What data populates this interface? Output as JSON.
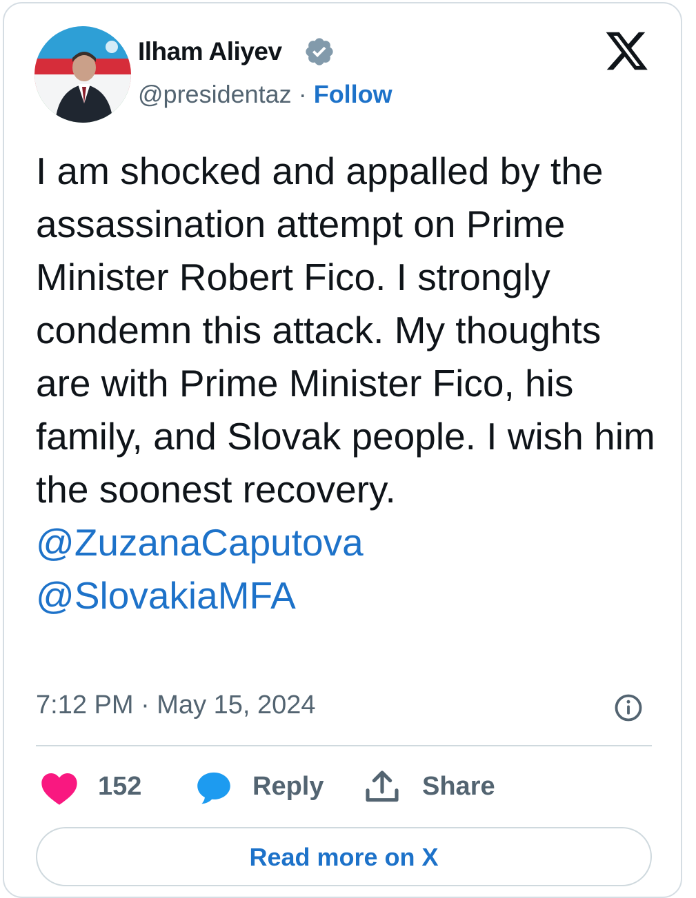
{
  "author": {
    "name": "Ilham Aliyev",
    "handle": "@presidentaz",
    "separator": "·",
    "follow_label": "Follow",
    "verified": true
  },
  "tweet": {
    "text": "I am shocked and appalled by the assassination attempt on Prime Minister Robert Fico. I strongly condemn this attack. My thoughts are with Prime Minister Fico, his family, and Slovak people. I wish him the soonest recovery.",
    "mentions": [
      "@ZuzanaCaputova",
      "@SlovakiaMFA"
    ],
    "timestamp": "7:12 PM · May 15, 2024"
  },
  "actions": {
    "like_count": "152",
    "reply_label": "Reply",
    "share_label": "Share"
  },
  "read_more_label": "Read more on X",
  "icons": {
    "brand": "x-logo-icon",
    "verified": "verified-badge-icon",
    "info": "info-icon",
    "like": "heart-icon",
    "reply": "speech-bubble-icon",
    "share": "share-upload-icon"
  },
  "colors": {
    "link": "#1d72c9",
    "text": "#0f1419",
    "secondary": "#536471",
    "heart": "#f91880",
    "reply_bubble": "#1d9bf0",
    "border": "#cfd9de"
  }
}
